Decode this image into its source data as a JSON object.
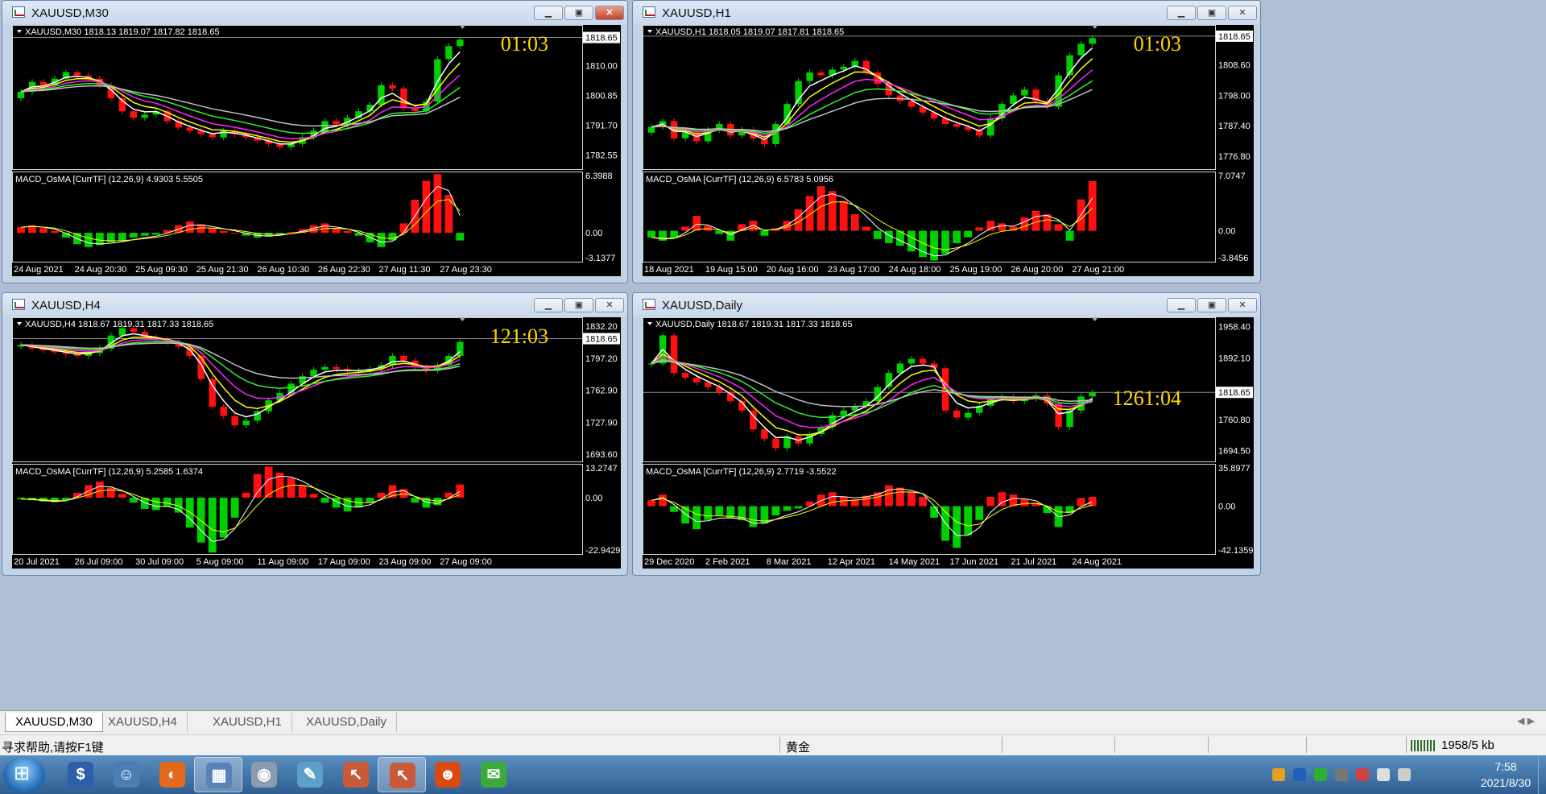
{
  "tabs": [
    {
      "label": "XAUUSD,M30",
      "active": true
    },
    {
      "label": "XAUUSD,H4",
      "active": false
    },
    {
      "label": "XAUUSD,H1",
      "active": false
    },
    {
      "label": "XAUUSD,Daily",
      "active": false
    }
  ],
  "status": {
    "help": "寻求帮助,请按F1键",
    "symbol": "黄金",
    "connection": "1958/5 kb"
  },
  "clock": {
    "time": "7:58",
    "date": "2021/8/30"
  },
  "taskbar_apps": [
    {
      "name": "trading-app-icon",
      "glyph": "$",
      "color": "#2b5fa8",
      "active": false
    },
    {
      "name": "users-app-icon",
      "glyph": "☺",
      "color": "#4a7fb5",
      "active": false
    },
    {
      "name": "browser-app-icon",
      "glyph": "◐",
      "color": "#e36a1a",
      "active": false
    },
    {
      "name": "metatrader-app-icon",
      "glyph": "▦",
      "color": "#5a82b8",
      "active": true
    },
    {
      "name": "disk-app-icon",
      "glyph": "◉",
      "color": "#8a9bb0",
      "active": false
    },
    {
      "name": "notepad-app-icon",
      "glyph": "✎",
      "color": "#5ca0c8",
      "active": false
    },
    {
      "name": "chart-tool-app-icon",
      "glyph": "↖",
      "color": "#c85a3a",
      "active": false
    },
    {
      "name": "chart-tool2-app-icon",
      "glyph": "↖",
      "color": "#c85a3a",
      "active": true
    },
    {
      "name": "ninja-app-icon",
      "glyph": "☻",
      "color": "#d84a10",
      "active": false
    },
    {
      "name": "wechat-app-icon",
      "glyph": "✉",
      "color": "#3aaa3a",
      "active": false
    }
  ],
  "colors": {
    "bull": "#00d000",
    "bear": "#ff1010",
    "ma_white": "#ffffff",
    "ma_yellow": "#ffff00",
    "ma_magenta": "#ff22ff",
    "ma_green": "#33ee33",
    "ma_gray": "#c0c0c0",
    "countdown": "#ffd700"
  },
  "charts": [
    {
      "id": "m30",
      "title": "XAUUSD,M30",
      "info": "XAUUSD,M30  1818.13 1819.07 1817.82 1818.65",
      "countdown": "01:03",
      "countdown_pos": "top-right",
      "price_ticks": [
        "1818.65",
        "1810.00",
        "1800.85",
        "1791.70",
        "1782.55"
      ],
      "ylim": [
        1778,
        1822
      ],
      "current": 1818.65,
      "macd_label": "MACD_OsMA [CurrTF] (12,26,9) 4.9303 5.5505",
      "macd_ticks": [
        "6.3988",
        "0.00",
        "-3.1377"
      ],
      "macd_lim": [
        -3.1377,
        6.3988
      ],
      "time_labels": [
        "24 Aug 2021",
        "24 Aug 20:30",
        "25 Aug 09:30",
        "25 Aug 21:30",
        "26 Aug 10:30",
        "26 Aug 22:30",
        "27 Aug 11:30",
        "27 Aug 23:30"
      ],
      "close": [
        1802,
        1805,
        1804,
        1806,
        1808,
        1807,
        1806,
        1804,
        1800,
        1796,
        1794,
        1795,
        1796,
        1793,
        1791,
        1790,
        1789,
        1788,
        1790,
        1789,
        1788,
        1787,
        1786,
        1785,
        1786,
        1788,
        1790,
        1793,
        1792,
        1794,
        1796,
        1798,
        1804,
        1803,
        1797,
        1796,
        1799,
        1812,
        1816,
        1818
      ],
      "macd": [
        0.6,
        0.8,
        0.5,
        0.2,
        -0.5,
        -1.2,
        -1.5,
        -1.3,
        -1.0,
        -0.8,
        -0.5,
        -0.3,
        -0.2,
        0.3,
        0.8,
        1.2,
        0.9,
        0.5,
        0.2,
        0.0,
        -0.3,
        -0.5,
        -0.4,
        -0.2,
        0.1,
        0.4,
        0.8,
        1.0,
        0.5,
        0.2,
        -0.3,
        -1.0,
        -1.5,
        -0.8,
        1.0,
        3.5,
        5.5,
        6.2,
        4.0,
        -0.8
      ]
    },
    {
      "id": "h1",
      "title": "XAUUSD,H1",
      "info": "XAUUSD,H1  1818.05 1819.07 1817.81 1818.65",
      "countdown": "01:03",
      "countdown_pos": "top-right",
      "price_ticks": [
        "1818.65",
        "1808.60",
        "1798.00",
        "1787.40",
        "1776.80"
      ],
      "ylim": [
        1772,
        1822
      ],
      "current": 1818.65,
      "macd_label": "MACD_OsMA [CurrTF] (12,26,9) 6.5783 5.0956",
      "macd_ticks": [
        "7.0747",
        "0.00",
        "-3.8456"
      ],
      "macd_lim": [
        -3.8456,
        7.0747
      ],
      "time_labels": [
        "18 Aug 2021",
        "19 Aug 15:00",
        "20 Aug 16:00",
        "23 Aug 17:00",
        "24 Aug 18:00",
        "25 Aug 19:00",
        "26 Aug 20:00",
        "27 Aug 21:00"
      ],
      "close": [
        1787,
        1789,
        1783,
        1785,
        1782,
        1786,
        1788,
        1784,
        1786,
        1783,
        1781,
        1788,
        1795,
        1803,
        1806,
        1805,
        1807,
        1808,
        1810,
        1806,
        1802,
        1798,
        1796,
        1794,
        1792,
        1790,
        1788,
        1787,
        1786,
        1784,
        1790,
        1795,
        1798,
        1800,
        1796,
        1794,
        1805,
        1812,
        1816,
        1818
      ],
      "macd": [
        -0.8,
        -1.2,
        -0.9,
        0.5,
        1.8,
        0.6,
        -0.4,
        -1.2,
        0.8,
        1.2,
        -0.6,
        0.3,
        1.2,
        2.6,
        4.2,
        5.4,
        4.8,
        3.6,
        2.0,
        0.5,
        -1.0,
        -1.5,
        -1.8,
        -2.5,
        -3.2,
        -3.6,
        -2.8,
        -1.5,
        -0.8,
        0.4,
        1.2,
        0.9,
        0.5,
        1.6,
        2.4,
        2.0,
        0.8,
        -1.2,
        3.8,
        6.0
      ]
    },
    {
      "id": "h4",
      "title": "XAUUSD,H4",
      "info": "XAUUSD,H4  1818.67 1819.31 1817.33 1818.65",
      "countdown": "121:03",
      "countdown_pos": "top-right",
      "price_ticks": [
        "1832.20",
        "1818.65",
        "1797.20",
        "1762.90",
        "1727.90",
        "1693.60"
      ],
      "ylim": [
        1685,
        1840
      ],
      "current": 1818.65,
      "macd_label": "MACD_OsMA [CurrTF] (12,26,9) 5.2585 1.6374",
      "macd_ticks": [
        "13.2747",
        "0.00",
        "-22.9429"
      ],
      "macd_lim": [
        -22.9429,
        13.2747
      ],
      "time_labels": [
        "20 Jul 2021",
        "26 Jul 09:00",
        "30 Jul 09:00",
        "5 Aug 09:00",
        "11 Aug 09:00",
        "17 Aug 09:00",
        "23 Aug 09:00",
        "27 Aug 09:00"
      ],
      "close": [
        1812,
        1808,
        1806,
        1804,
        1802,
        1800,
        1803,
        1808,
        1822,
        1830,
        1826,
        1820,
        1818,
        1815,
        1810,
        1800,
        1775,
        1745,
        1735,
        1725,
        1730,
        1740,
        1752,
        1760,
        1770,
        1778,
        1785,
        1788,
        1786,
        1784,
        1784,
        1786,
        1790,
        1800,
        1795,
        1788,
        1784,
        1790,
        1800,
        1815
      ],
      "macd": [
        -0.5,
        -1.0,
        -1.5,
        -1.8,
        -1.0,
        2.0,
        5.0,
        6.5,
        4.0,
        1.5,
        -2.0,
        -4.5,
        -5.0,
        -3.5,
        -6.0,
        -12.0,
        -18.0,
        -22.0,
        -16.0,
        -8.0,
        2.0,
        9.5,
        12.5,
        10.0,
        8.0,
        5.0,
        1.5,
        -2.0,
        -4.0,
        -5.5,
        -4.0,
        -2.0,
        2.0,
        5.0,
        3.5,
        -2.0,
        -4.0,
        -3.0,
        2.0,
        5.3
      ]
    },
    {
      "id": "daily",
      "title": "XAUUSD,Daily",
      "info": "XAUUSD,Daily  1818.67 1819.31 1817.33 1818.65",
      "countdown": "1261:04",
      "countdown_pos": "middle-right",
      "price_ticks": [
        "1958.40",
        "1892.10",
        "1818.65",
        "1760.80",
        "1694.50"
      ],
      "ylim": [
        1670,
        1975
      ],
      "current": 1818.65,
      "macd_label": "MACD_OsMA [CurrTF] (12,26,9) 2.7719 -3.5522",
      "macd_ticks": [
        "35.8977",
        "0.00",
        "-42.1359"
      ],
      "macd_lim": [
        -42.1359,
        35.8977
      ],
      "time_labels": [
        "29 Dec 2020",
        "2 Feb 2021",
        "8 Mar 2021",
        "12 Apr 2021",
        "14 May 2021",
        "17 Jun 2021",
        "21 Jul 2021",
        "24 Aug 2021"
      ],
      "close": [
        1880,
        1940,
        1860,
        1850,
        1840,
        1830,
        1820,
        1800,
        1780,
        1740,
        1720,
        1700,
        1725,
        1710,
        1730,
        1745,
        1770,
        1780,
        1790,
        1800,
        1830,
        1860,
        1880,
        1890,
        1880,
        1870,
        1780,
        1765,
        1775,
        1790,
        1805,
        1810,
        1800,
        1805,
        1812,
        1795,
        1745,
        1780,
        1810,
        1818
      ],
      "macd": [
        5.0,
        10.0,
        -5.0,
        -15.0,
        -20.0,
        -12.0,
        -8.0,
        -10.0,
        -12.0,
        -18.0,
        -15.0,
        -8.0,
        -4.0,
        -2.0,
        4.0,
        10.0,
        12.0,
        8.0,
        6.0,
        9.0,
        12.0,
        18.0,
        16.0,
        12.0,
        8.0,
        -10.0,
        -30.0,
        -36.0,
        -25.0,
        -12.0,
        8.0,
        12.0,
        10.0,
        6.0,
        3.0,
        -6.0,
        -18.0,
        -6.0,
        7.0,
        8.0
      ]
    }
  ]
}
